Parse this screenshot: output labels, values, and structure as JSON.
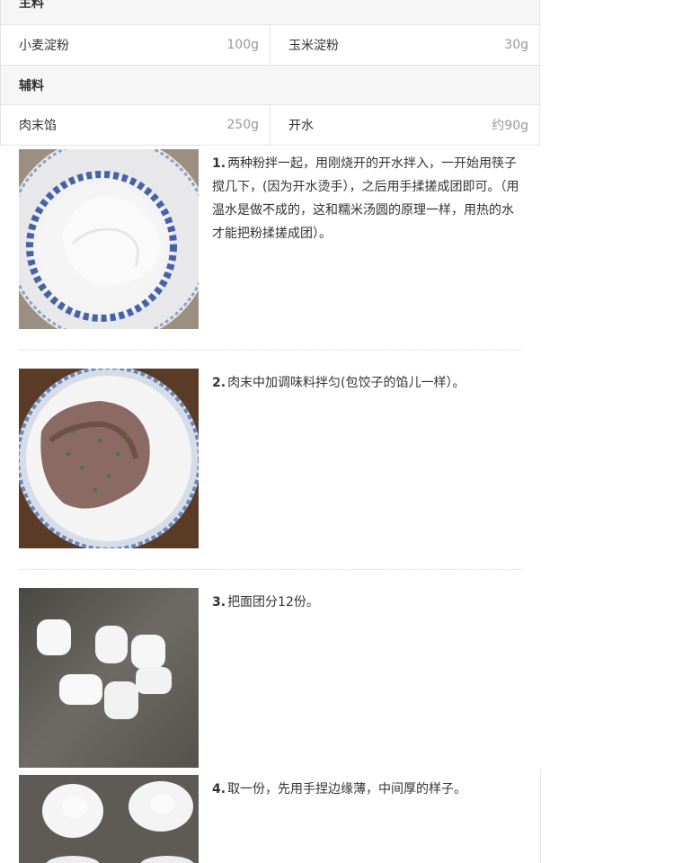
{
  "ingredients": {
    "main_label": "主料",
    "main": [
      {
        "name": "小麦淀粉",
        "amount": "100g"
      },
      {
        "name": "玉米淀粉",
        "amount": "30g"
      }
    ],
    "aux_label": "辅料",
    "aux": [
      {
        "name": "肉末馅",
        "amount": "250g"
      },
      {
        "name": "开水",
        "amount": "约90g"
      }
    ]
  },
  "steps": [
    {
      "num": "1.",
      "text": "两种粉拌一起，用刚烧开的开水拌入，一开始用筷子搅几下，(因为开水烫手），之后用手揉搓成团即可。（用温水是做不成的，这和糯米汤圆的原理一样，用热的水才能把粉揉搓成团）。",
      "image": "white-dough-in-blue-bowl"
    },
    {
      "num": "2.",
      "text": "肉末中加调味料拌匀(包饺子的馅儿一样）。",
      "image": "minced-meat-in-bowl"
    },
    {
      "num": "3.",
      "text": "把面团分12份。",
      "image": "dough-pieces"
    },
    {
      "num": "4.",
      "text": "取一份，先用手捏边缘薄，中间厚的样子。",
      "image": "flattened-dough"
    }
  ]
}
